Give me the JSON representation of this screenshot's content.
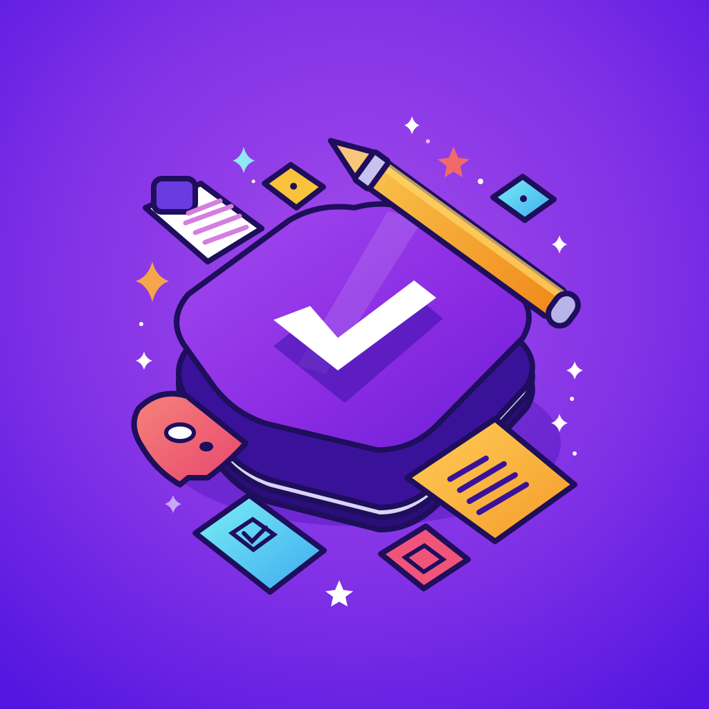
{
  "illustration": {
    "subject": "task-complete-app-icon",
    "colors": {
      "background_top": "#9D3FE8",
      "background_bottom": "#5A18E6",
      "button_face": "#8A2BE2",
      "button_dark": "#3A129A",
      "checkmark": "#FFFFFF",
      "pencil_body": "#F5A623",
      "pencil_tip": "#F4B860",
      "sticky_note": "#F8B33A",
      "chat_bubble": "#F0646E",
      "cyan_tile": "#4FD3E8",
      "yellow_tile": "#F9C23C",
      "red_tile": "#F0547A",
      "outline": "#1E0E5C"
    },
    "icons": [
      "checkmark-button-icon",
      "pencil-icon",
      "clipboard-document-icon",
      "chat-bubble-icon",
      "sticky-note-icon",
      "checkbox-card-icon",
      "yellow-square-tile-icon",
      "cyan-square-tile-icon",
      "red-square-tile-icon",
      "sparkle-star-icon"
    ]
  }
}
